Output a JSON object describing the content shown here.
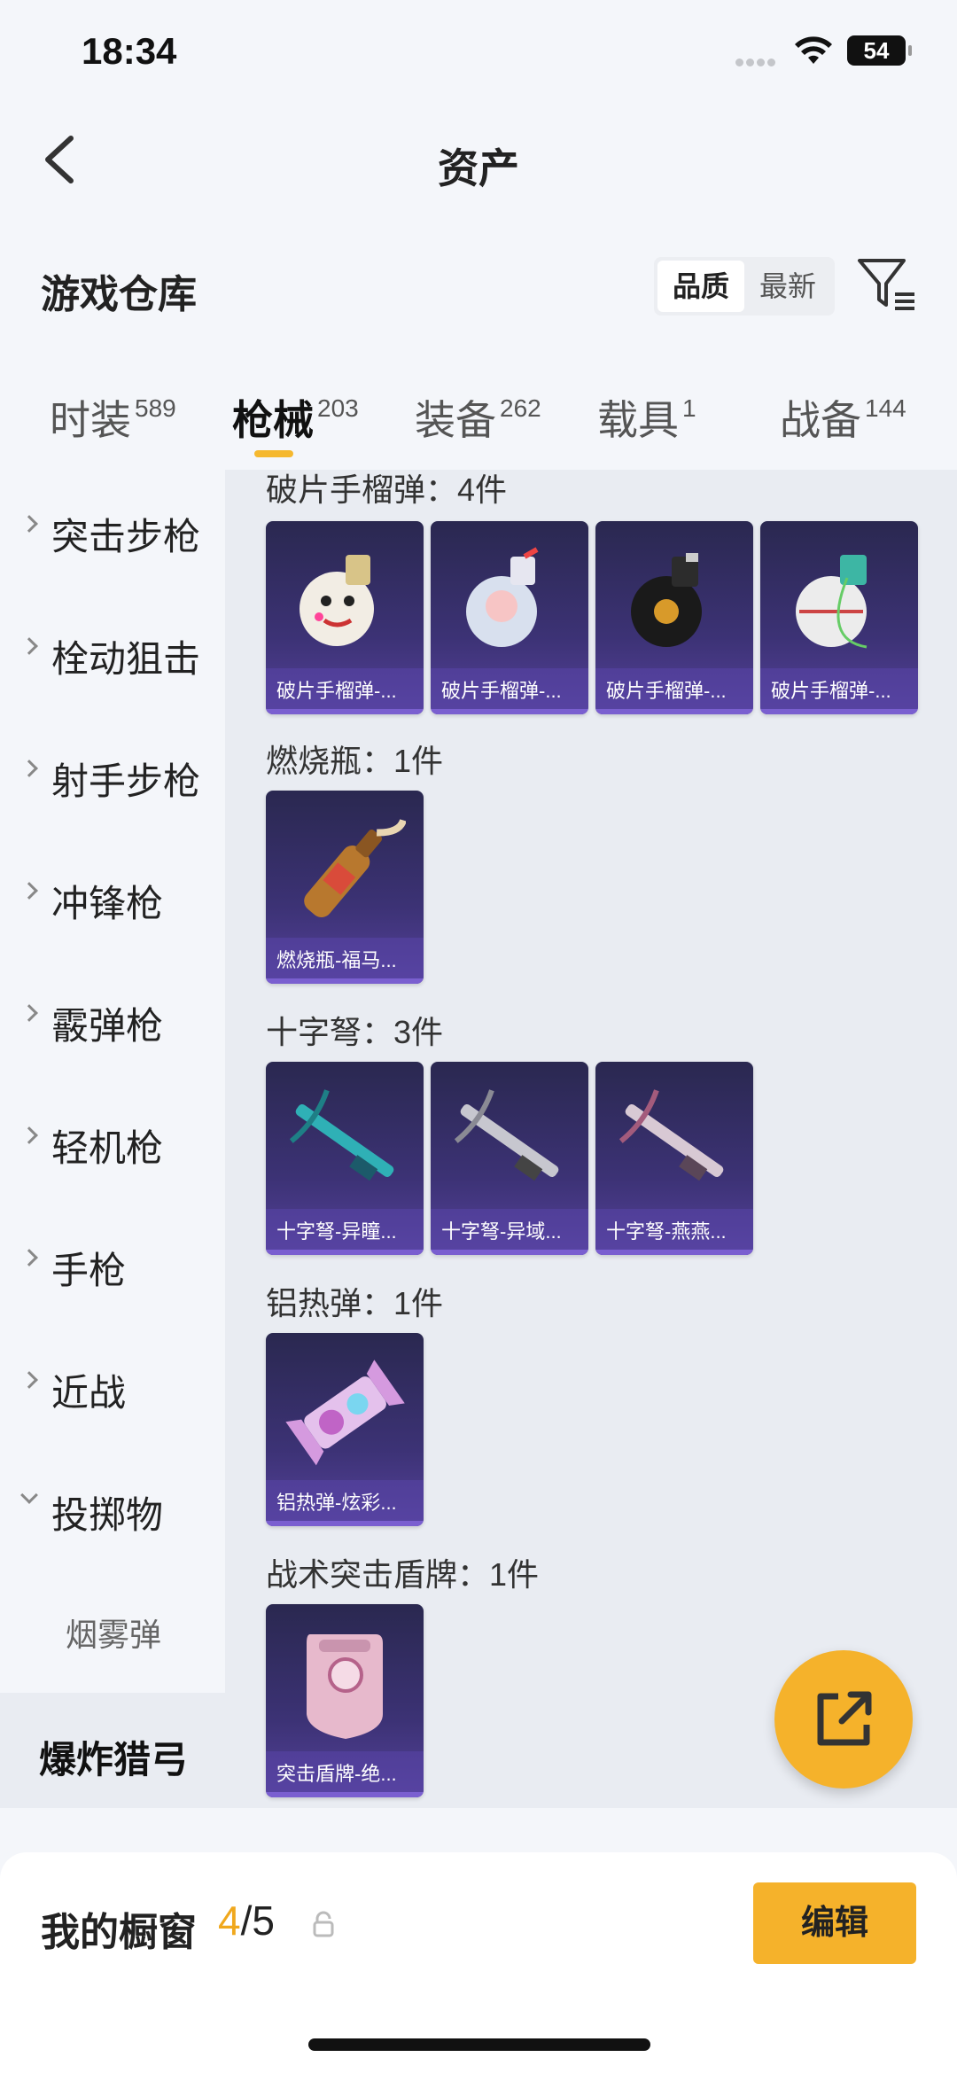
{
  "status_bar": {
    "time": "18:34",
    "battery": "54"
  },
  "nav": {
    "title": "资产"
  },
  "warehouse": {
    "title": "游戏仓库"
  },
  "sort": {
    "options": [
      "品质",
      "最新"
    ],
    "selected": "品质"
  },
  "tabs": [
    {
      "label": "时装",
      "count": "589"
    },
    {
      "label": "枪械",
      "count": "203",
      "active": true
    },
    {
      "label": "装备",
      "count": "262"
    },
    {
      "label": "载具",
      "count": "1"
    },
    {
      "label": "战备",
      "count": "144"
    }
  ],
  "sidebar": {
    "items": [
      {
        "label": "突击步枪"
      },
      {
        "label": "栓动狙击"
      },
      {
        "label": "射手步枪"
      },
      {
        "label": "冲锋枪"
      },
      {
        "label": "霰弹枪"
      },
      {
        "label": "轻机枪"
      },
      {
        "label": "手枪"
      },
      {
        "label": "近战"
      },
      {
        "label": "投掷物",
        "expanded": true
      }
    ],
    "sub_items": [
      {
        "label": "烟雾弹"
      }
    ],
    "selected": {
      "label": "爆炸猎弓"
    }
  },
  "groups": [
    {
      "title": "破片手榴弹：4件",
      "items": [
        {
          "caption": "破片手榴弹-..."
        },
        {
          "caption": "破片手榴弹-..."
        },
        {
          "caption": "破片手榴弹-..."
        },
        {
          "caption": "破片手榴弹-..."
        }
      ]
    },
    {
      "title": "燃烧瓶：1件",
      "items": [
        {
          "caption": "燃烧瓶-福马..."
        }
      ]
    },
    {
      "title": "十字弩：3件",
      "items": [
        {
          "caption": "十字弩-异瞳..."
        },
        {
          "caption": "十字弩-异域..."
        },
        {
          "caption": "十字弩-燕燕..."
        }
      ]
    },
    {
      "title": "铝热弹：1件",
      "items": [
        {
          "caption": "铝热弹-炫彩..."
        }
      ]
    },
    {
      "title": "战术突击盾牌：1件",
      "items": [
        {
          "caption": "突击盾牌-绝..."
        }
      ]
    }
  ],
  "showcase": {
    "title": "我的橱窗",
    "current": "4",
    "total": "/5",
    "edit_label": "编辑"
  }
}
